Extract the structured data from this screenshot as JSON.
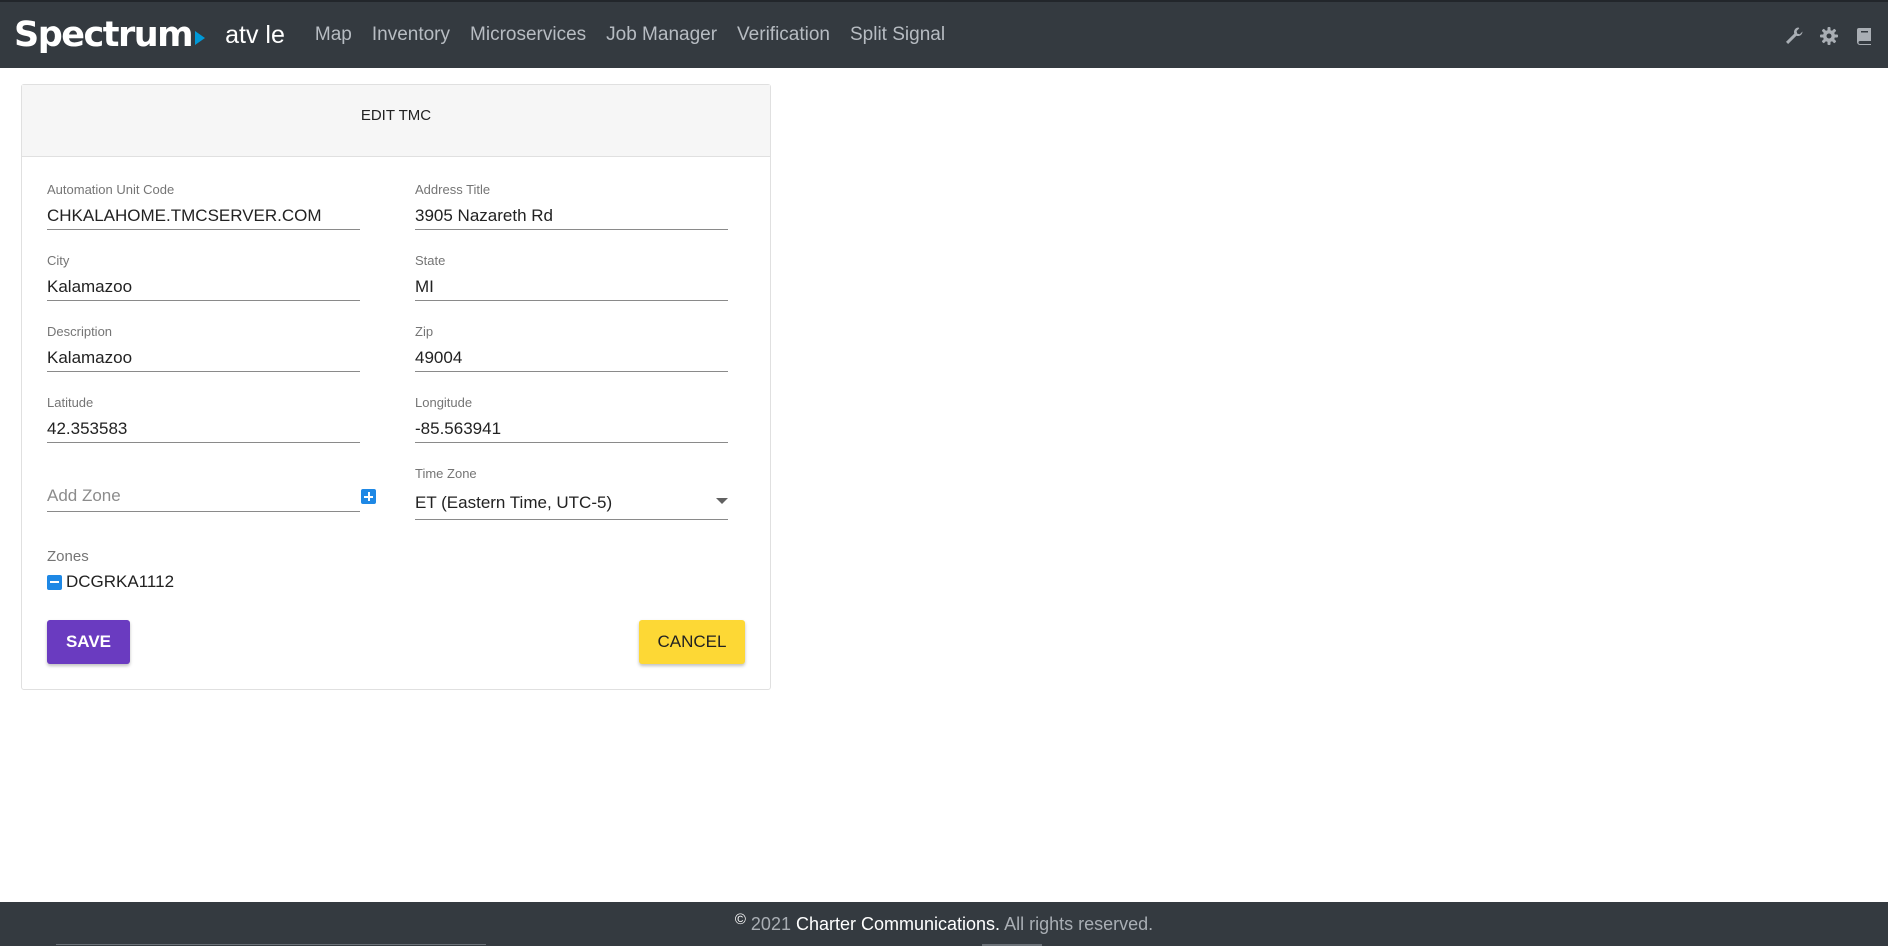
{
  "header": {
    "brand": "Spectrum",
    "app_name": "atv le",
    "nav": [
      "Map",
      "Inventory",
      "Microservices",
      "Job Manager",
      "Verification",
      "Split Signal"
    ],
    "tools": [
      "wrench-icon",
      "gear-icon",
      "book-icon"
    ]
  },
  "card": {
    "title": "EDIT TMC",
    "fields": {
      "automation_unit_code": {
        "label": "Automation Unit Code",
        "value": "CHKALAHOME.TMCSERVER.COM"
      },
      "address_title": {
        "label": "Address Title",
        "value": "3905 Nazareth Rd"
      },
      "city": {
        "label": "City",
        "value": "Kalamazoo"
      },
      "state": {
        "label": "State",
        "value": "MI"
      },
      "description": {
        "label": "Description",
        "value": "Kalamazoo"
      },
      "zip": {
        "label": "Zip",
        "value": "49004"
      },
      "latitude": {
        "label": "Latitude",
        "value": "42.353583"
      },
      "longitude": {
        "label": "Longitude",
        "value": "-85.563941"
      }
    },
    "add_zone_placeholder": "Add Zone",
    "time_zone": {
      "label": "Time Zone",
      "value": "ET (Eastern Time, UTC-5)"
    },
    "zones_label": "Zones",
    "zones": [
      "DCGRKA1112"
    ],
    "save_label": "SAVE",
    "cancel_label": "CANCEL"
  },
  "footer": {
    "copyright_symbol": "©",
    "year": "2021",
    "company": "Charter Communications.",
    "rights": "All rights reserved."
  },
  "colors": {
    "header_bg": "#343a40",
    "save_button": "#6a3bc0",
    "cancel_button": "#fdd835",
    "icon_button": "#1e88e5",
    "brand_arrow": "#0099d8"
  }
}
